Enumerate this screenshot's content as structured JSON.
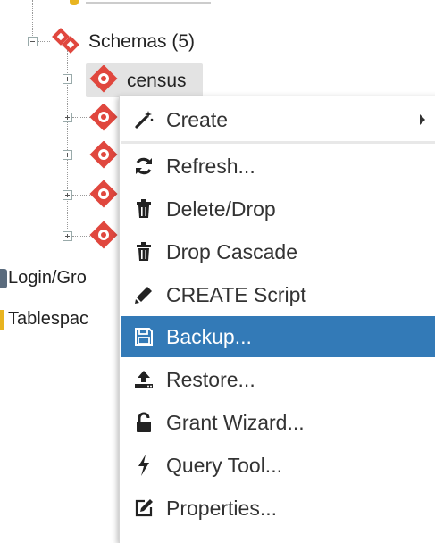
{
  "tree": {
    "schemas_label": "Schemas (5)",
    "selected_schema": "census",
    "login_label": "Login/Gro",
    "tablespace_label": "Tablespac"
  },
  "menu": {
    "items": [
      {
        "label": "Create",
        "icon": "magic-wand-icon",
        "submenu": true
      },
      {
        "label": "Refresh...",
        "icon": "refresh-icon"
      },
      {
        "label": "Delete/Drop",
        "icon": "trash-icon"
      },
      {
        "label": "Drop Cascade",
        "icon": "trash-icon"
      },
      {
        "label": "CREATE Script",
        "icon": "pencil-icon"
      },
      {
        "label": "Backup...",
        "icon": "floppy-disk-icon",
        "active": true
      },
      {
        "label": "Restore...",
        "icon": "upload-icon"
      },
      {
        "label": "Grant Wizard...",
        "icon": "lock-icon"
      },
      {
        "label": "Query Tool...",
        "icon": "bolt-icon"
      },
      {
        "label": "Properties...",
        "icon": "edit-icon"
      }
    ]
  },
  "colors": {
    "accent": "#337ab7",
    "schema_icon": "#e0473e",
    "selected_bg": "#e3e3e3"
  }
}
